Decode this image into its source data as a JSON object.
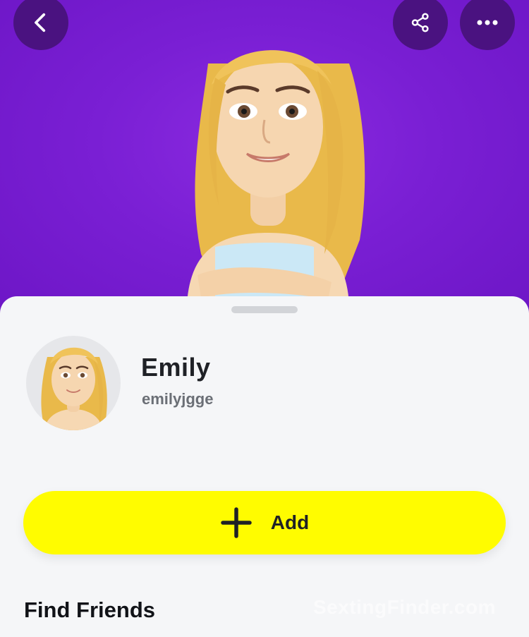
{
  "header": {
    "back_icon": "chevron-left-icon",
    "share_icon": "share-icon",
    "more_icon": "more-horizontal-icon",
    "background_color": "#7a1fd4"
  },
  "profile": {
    "display_name": "Emily",
    "username": "emilyjgge"
  },
  "actions": {
    "add_label": "Add",
    "add_icon": "plus-icon",
    "add_color": "#fffc00"
  },
  "sections": {
    "find_friends_title": "Find Friends"
  },
  "watermark": "SextingFinder.com"
}
